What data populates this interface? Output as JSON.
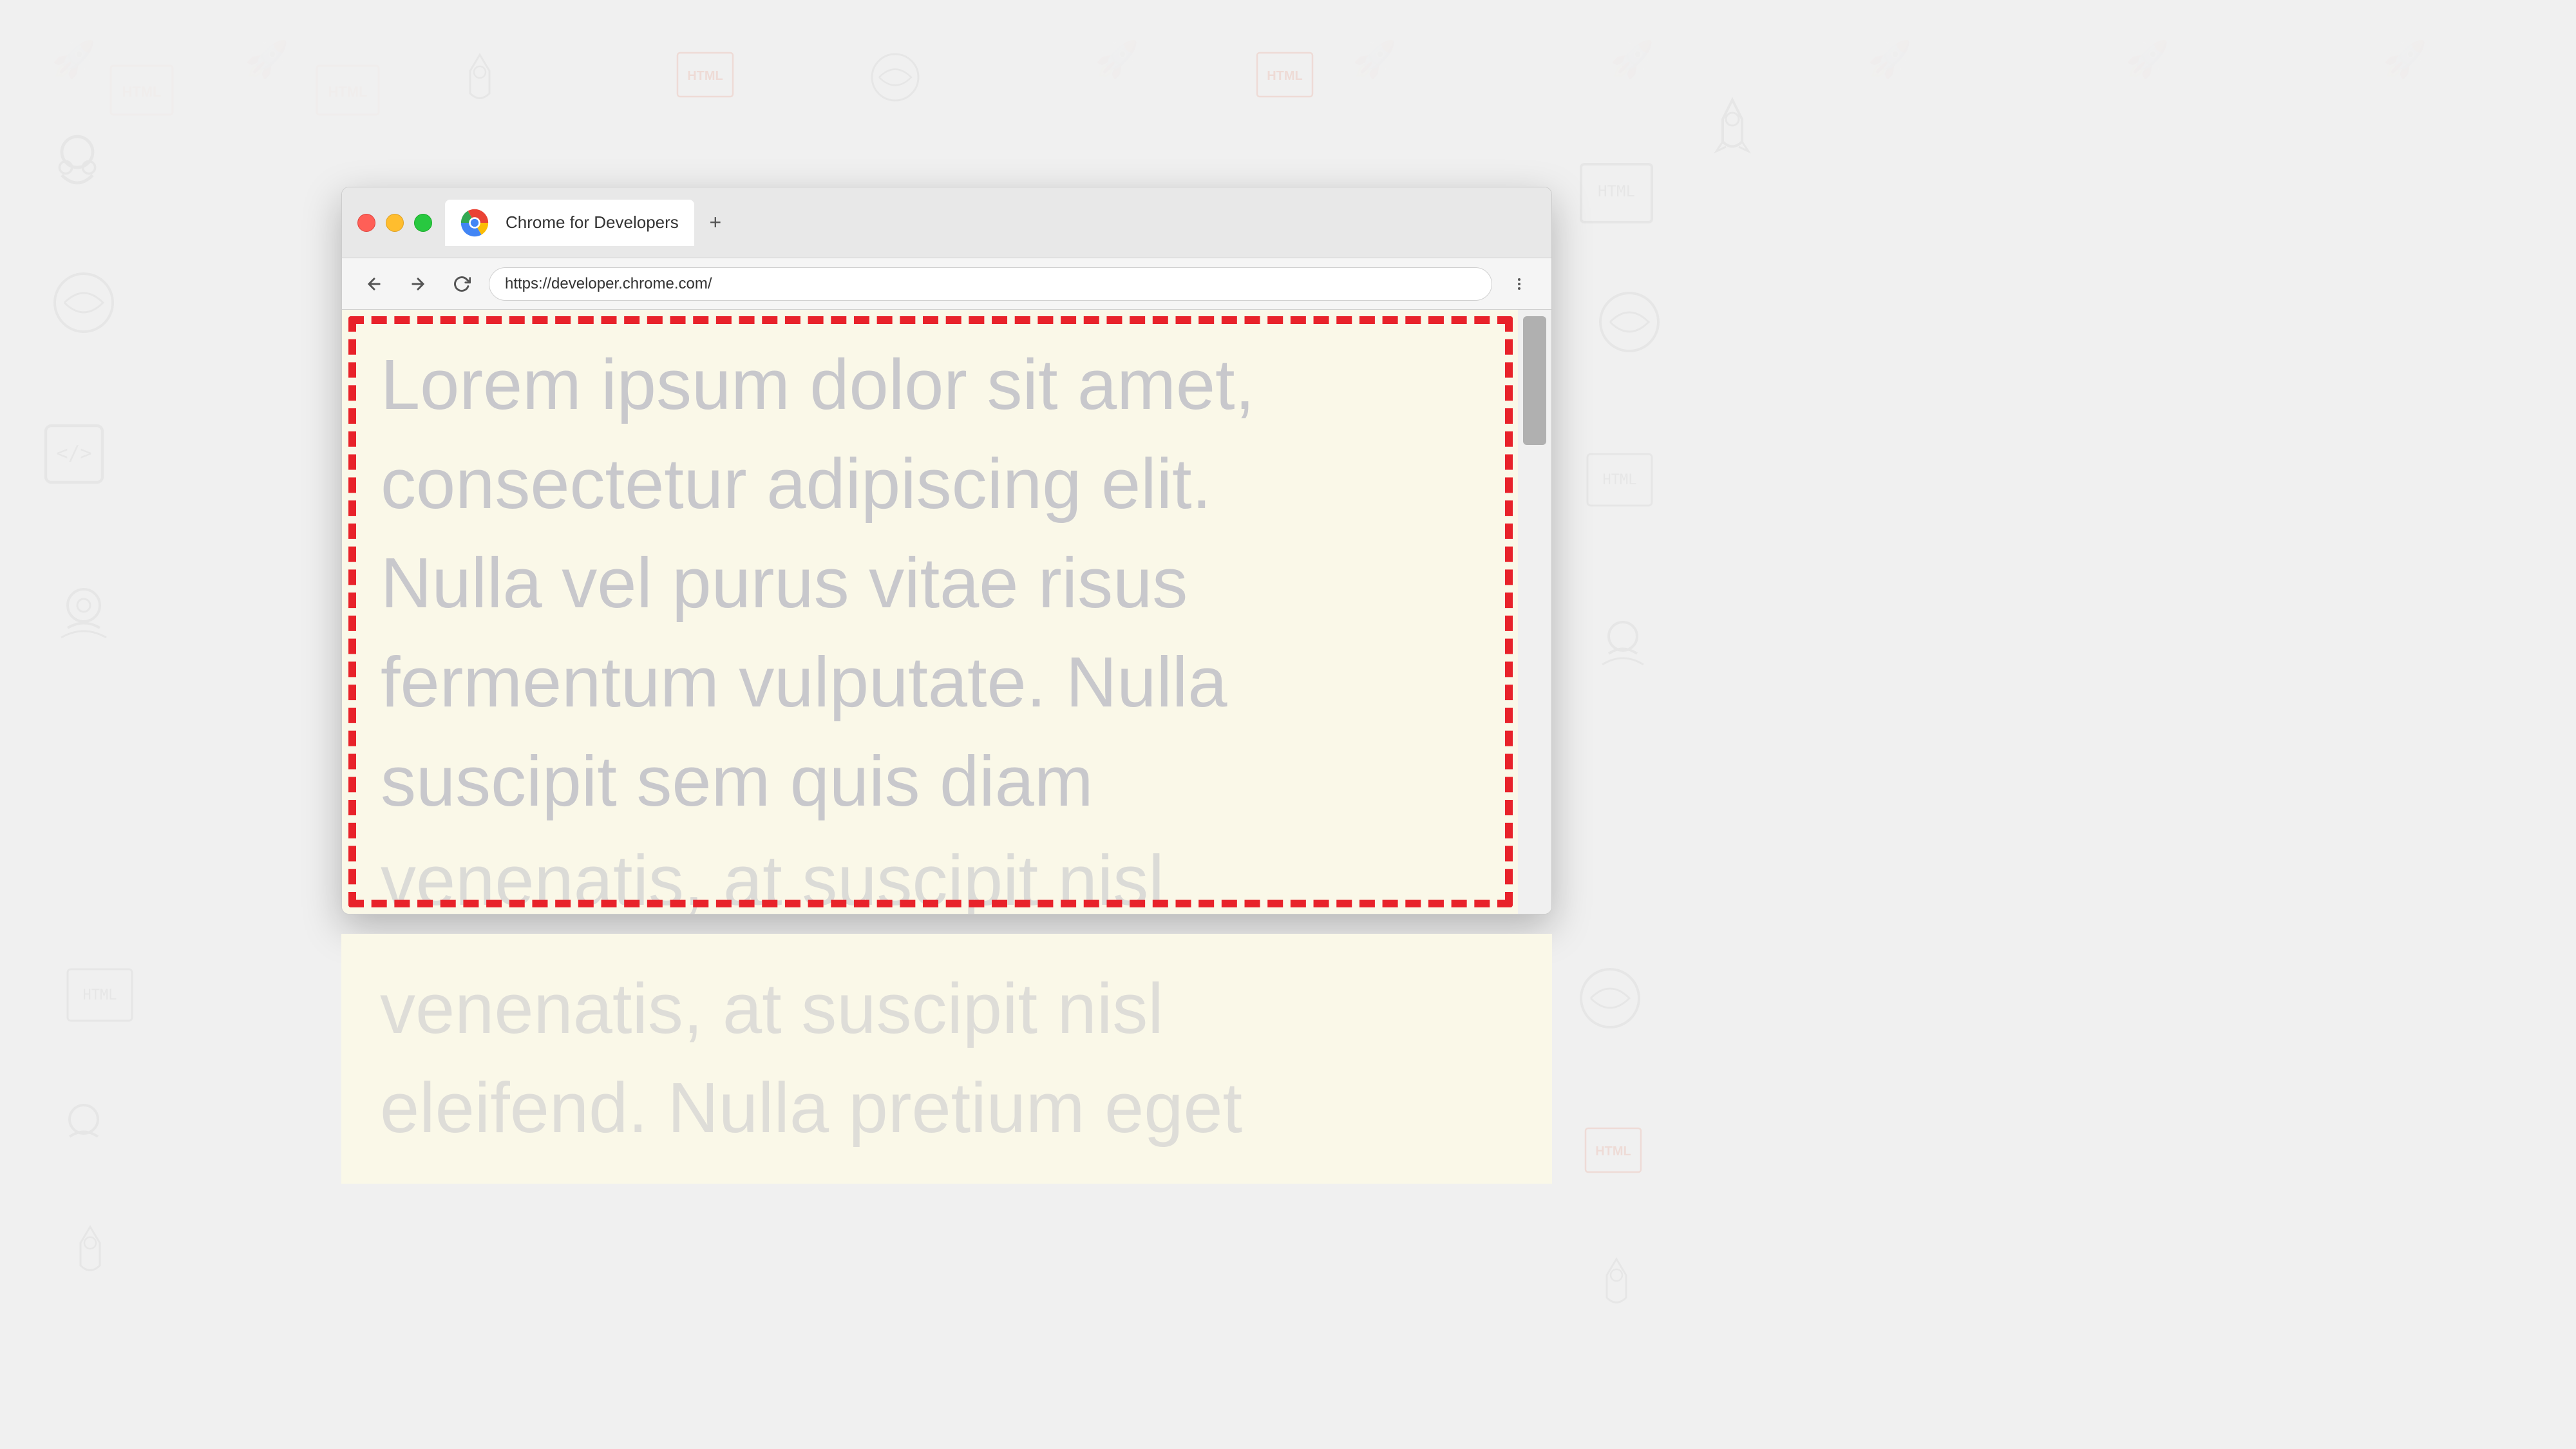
{
  "background": {
    "color": "#f0f0f0"
  },
  "browser": {
    "tab": {
      "title": "Chrome for Developers",
      "url": "https://developer.chrome.com/",
      "new_tab_label": "+"
    },
    "nav": {
      "back_disabled": false,
      "forward_disabled": false,
      "url": "https://developer.chrome.com/"
    },
    "traffic_lights": {
      "red": "#ff5f57",
      "yellow": "#ffbd2e",
      "green": "#28c840"
    },
    "content": {
      "background": "#faf8e8",
      "lorem_text": "Lorem ipsum dolor sit amet, consectetur adipiscing elit. Nulla vel purus vitae risus fermentum vulputate. Nulla suscipit sem quis diam venenatis, at suscipit nisl eleifend. Nulla pretium eget"
    },
    "dashed_border": {
      "color": "#e8222a"
    }
  }
}
